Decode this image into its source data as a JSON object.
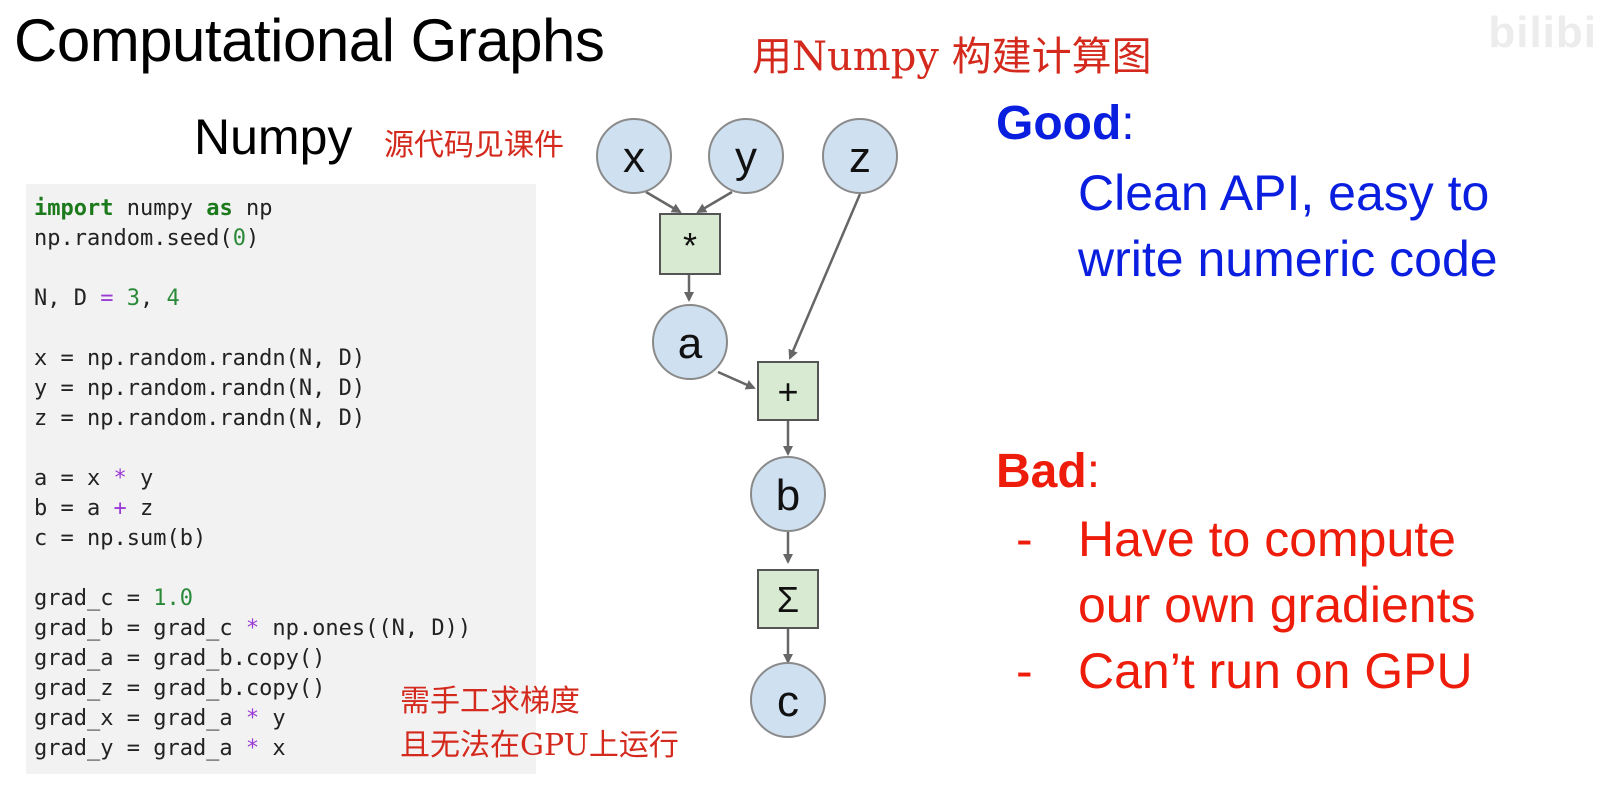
{
  "slide": {
    "title": "Computational Graphs",
    "annotation_title": "用Numpy 构建计算图",
    "numpy_label": "Numpy",
    "annotation_source": "源代码见课件",
    "annotation_note": [
      "需手工求梯度",
      "且无法在GPU上运行"
    ],
    "watermark": "bilibi"
  },
  "code": {
    "lines": [
      [
        {
          "t": "import",
          "c": "kw"
        },
        {
          "t": " numpy "
        },
        {
          "t": "as",
          "c": "kw"
        },
        {
          "t": " np"
        }
      ],
      [
        {
          "t": "np.random.seed("
        },
        {
          "t": "0",
          "c": "num"
        },
        {
          "t": ")"
        }
      ],
      [],
      [
        {
          "t": "N, D "
        },
        {
          "t": "=",
          "c": "op"
        },
        {
          "t": " "
        },
        {
          "t": "3",
          "c": "num"
        },
        {
          "t": ", "
        },
        {
          "t": "4",
          "c": "num"
        }
      ],
      [],
      [
        {
          "t": "x = np.random.randn(N, D)"
        }
      ],
      [
        {
          "t": "y = np.random.randn(N, D)"
        }
      ],
      [
        {
          "t": "z = np.random.randn(N, D)"
        }
      ],
      [],
      [
        {
          "t": "a = x "
        },
        {
          "t": "*",
          "c": "op"
        },
        {
          "t": " y"
        }
      ],
      [
        {
          "t": "b = a "
        },
        {
          "t": "+",
          "c": "op"
        },
        {
          "t": " z"
        }
      ],
      [
        {
          "t": "c = np.sum(b)"
        }
      ],
      [],
      [
        {
          "t": "grad_c = "
        },
        {
          "t": "1.0",
          "c": "num"
        }
      ],
      [
        {
          "t": "grad_b = grad_c "
        },
        {
          "t": "*",
          "c": "op"
        },
        {
          "t": " np.ones((N, D))"
        }
      ],
      [
        {
          "t": "grad_a = grad_b.copy()"
        }
      ],
      [
        {
          "t": "grad_z = grad_b.copy()"
        }
      ],
      [
        {
          "t": "grad_x = grad_a "
        },
        {
          "t": "*",
          "c": "op"
        },
        {
          "t": " y"
        }
      ],
      [
        {
          "t": "grad_y = grad_a "
        },
        {
          "t": "*",
          "c": "op"
        },
        {
          "t": " x"
        }
      ]
    ]
  },
  "graph": {
    "nodes": [
      "x",
      "y",
      "z",
      "a",
      "b",
      "c"
    ],
    "ops": [
      "*",
      "+",
      "Σ"
    ],
    "colors": {
      "node_fill": "#cfe0f1",
      "node_stroke": "#8a8a8a",
      "op_fill": "#d9ead3",
      "op_stroke": "#555555",
      "edge": "#666666"
    }
  },
  "good": {
    "heading": "Good",
    "colon": ":",
    "lines": [
      "Clean API, easy to",
      "write numeric code"
    ],
    "color": "#0a1ee0"
  },
  "bad": {
    "heading": "Bad",
    "colon": ":",
    "dash": "-",
    "items": [
      [
        "Have to compute",
        "our own gradients"
      ],
      [
        "Can’t run on GPU"
      ]
    ],
    "color": "#ee1c0a"
  }
}
